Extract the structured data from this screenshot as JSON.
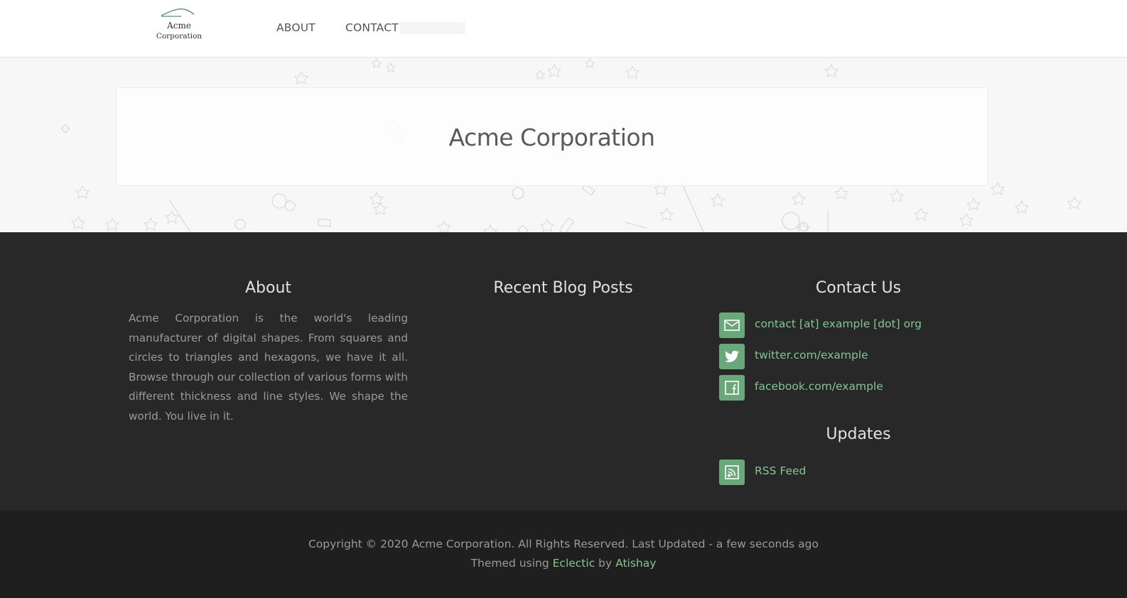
{
  "header": {
    "logo": {
      "line1": "Acme",
      "line2": "Corporation"
    },
    "nav": [
      {
        "label": "ABOUT"
      },
      {
        "label": "CONTACT"
      }
    ],
    "search": {
      "placeholder": ""
    }
  },
  "hero": {
    "title": "Acme Corporation"
  },
  "footer": {
    "about": {
      "heading": "About",
      "text": "Acme Corporation is the world's leading manufacturer of digital shapes. From squares and circles to triangles and hexagons, we have it all. Browse through our collection of various forms with different thickness and line styles. We shape the world. You live in it."
    },
    "blog": {
      "heading": "Recent Blog Posts"
    },
    "contact": {
      "heading": "Contact Us",
      "items": [
        {
          "icon": "mail-icon",
          "label": "contact [at] example [dot] org"
        },
        {
          "icon": "twitter-icon",
          "label": "twitter.com/example"
        },
        {
          "icon": "facebook-icon",
          "label": "facebook.com/example"
        }
      ]
    },
    "updates": {
      "heading": "Updates",
      "items": [
        {
          "icon": "rss-icon",
          "label": "RSS Feed"
        }
      ]
    }
  },
  "bottom": {
    "copyright": "Copyright © 2020 Acme Corporation. All Rights Reserved. Last Updated - a few seconds ago",
    "themed_prefix": "Themed using",
    "theme_link": "Eclectic",
    "by": "by",
    "author_link": "Atishay"
  },
  "colors": {
    "accent": "#82c691",
    "icon_bg": "#6aa879",
    "footer_bg": "#282828",
    "bottom_bg": "#1f1f1f"
  }
}
